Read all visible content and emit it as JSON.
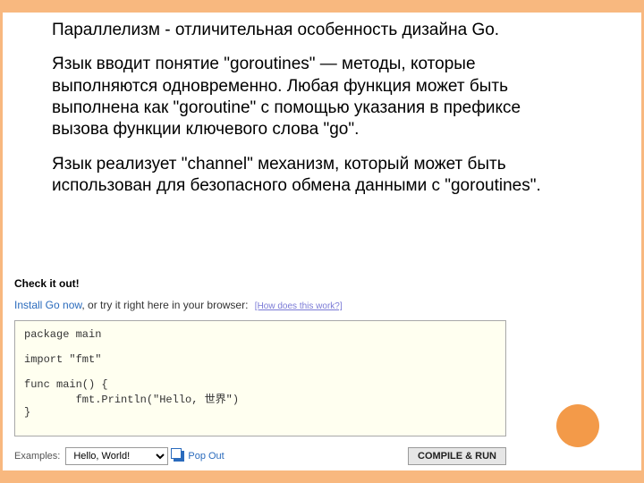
{
  "paragraphs": {
    "p1": "Параллелизм - отличительная особенность дизайна Go.",
    "p2": "Язык вводит понятие \"goroutines\" — методы, которые выполняются одновременно. Любая функция может быть выполнена как \"goroutine\" с помощью указания в префиксе вызова функции ключевого слова \"go\".",
    "p3": "Язык реализует \"channel\" механизм, который может быть использован для безопасного обмена данными с \"goroutines\"."
  },
  "widget": {
    "check_title": "Check it out!",
    "install_link": "Install Go now",
    "prompt_rest": ", or try it right here in your browser:",
    "how_link": "[How does this work?]",
    "code": "package main\n\nimport \"fmt\"\n\nfunc main() {\n        fmt.Println(\"Hello, 世界\")\n}",
    "examples_label": "Examples:",
    "examples_selected": "Hello, World!",
    "popout_label": "Pop Out",
    "run_label": "COMPILE & RUN"
  }
}
